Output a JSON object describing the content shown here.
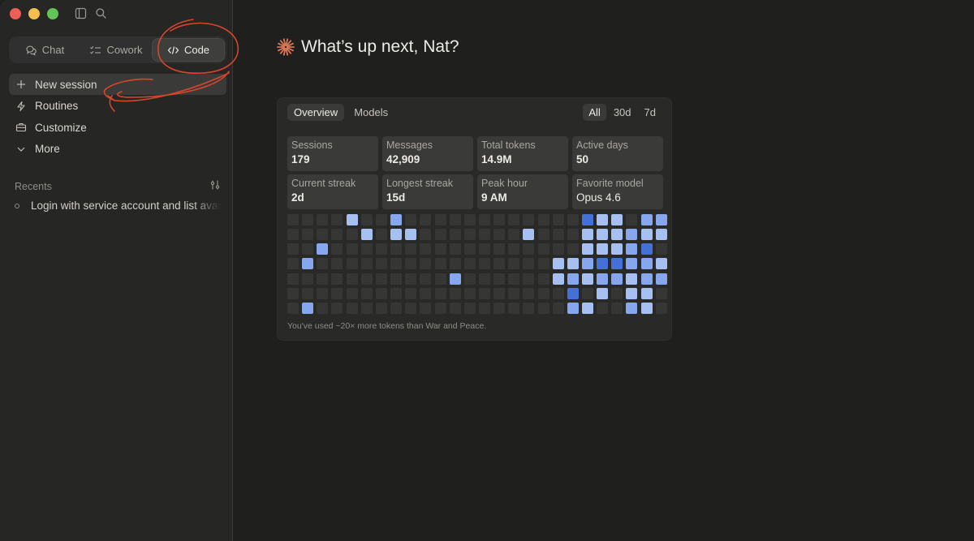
{
  "window": {
    "traffic_lights": [
      "close",
      "minimize",
      "zoom"
    ]
  },
  "sidebar": {
    "modes": [
      {
        "label": "Chat",
        "icon": "chat-bubbles-icon",
        "active": false
      },
      {
        "label": "Cowork",
        "icon": "checklist-icon",
        "active": false
      },
      {
        "label": "Code",
        "icon": "code-brackets-icon",
        "active": true
      }
    ],
    "nav": [
      {
        "label": "New session",
        "icon": "plus-icon",
        "active": true
      },
      {
        "label": "Routines",
        "icon": "lightning-icon",
        "active": false
      },
      {
        "label": "Customize",
        "icon": "briefcase-icon",
        "active": false
      },
      {
        "label": "More",
        "icon": "chevron-down-icon",
        "active": false
      }
    ],
    "recents_label": "Recents",
    "recents": [
      {
        "label": "Login with service account and list available"
      }
    ]
  },
  "main": {
    "greeting": "What’s up next, Nat?",
    "accent_color": "#d97757"
  },
  "stats_card": {
    "tabs": [
      {
        "label": "Overview",
        "active": true
      },
      {
        "label": "Models",
        "active": false
      }
    ],
    "ranges": [
      {
        "label": "All",
        "active": true
      },
      {
        "label": "30d",
        "active": false
      },
      {
        "label": "7d",
        "active": false
      }
    ],
    "stats": [
      {
        "label": "Sessions",
        "value": "179"
      },
      {
        "label": "Messages",
        "value": "42,909"
      },
      {
        "label": "Total tokens",
        "value": "14.9M"
      },
      {
        "label": "Active days",
        "value": "50"
      },
      {
        "label": "Current streak",
        "value": "2d"
      },
      {
        "label": "Longest streak",
        "value": "15d"
      },
      {
        "label": "Peak hour",
        "value": "9 AM"
      },
      {
        "label": "Favorite model",
        "value": "Opus 4.6"
      }
    ],
    "heatmap_colors": [
      "#363635",
      "#a6c0f2",
      "#86a6ee",
      "#4470d8"
    ],
    "heatmap": [
      [
        0,
        0,
        0,
        0,
        1,
        0,
        0,
        2,
        0,
        0,
        0,
        0,
        0,
        0,
        0,
        0,
        0,
        0,
        0,
        0,
        3,
        1,
        1,
        0,
        2,
        2
      ],
      [
        0,
        0,
        0,
        0,
        0,
        1,
        0,
        1,
        1,
        0,
        0,
        0,
        0,
        0,
        0,
        0,
        1,
        0,
        0,
        0,
        1,
        1,
        1,
        2,
        1,
        1
      ],
      [
        0,
        0,
        2,
        0,
        0,
        0,
        0,
        0,
        0,
        0,
        0,
        0,
        0,
        0,
        0,
        0,
        0,
        0,
        0,
        0,
        1,
        1,
        1,
        2,
        3,
        0
      ],
      [
        0,
        2,
        0,
        0,
        0,
        0,
        0,
        0,
        0,
        0,
        0,
        0,
        0,
        0,
        0,
        0,
        0,
        0,
        1,
        1,
        2,
        3,
        3,
        2,
        2,
        1
      ],
      [
        0,
        0,
        0,
        0,
        0,
        0,
        0,
        0,
        0,
        0,
        0,
        2,
        0,
        0,
        0,
        0,
        0,
        0,
        1,
        2,
        1,
        2,
        2,
        1,
        2,
        2
      ],
      [
        0,
        0,
        0,
        0,
        0,
        0,
        0,
        0,
        0,
        0,
        0,
        0,
        0,
        0,
        0,
        0,
        0,
        0,
        0,
        3,
        0,
        1,
        0,
        1,
        1,
        0
      ],
      [
        0,
        2,
        0,
        0,
        0,
        0,
        0,
        0,
        0,
        0,
        0,
        0,
        0,
        0,
        0,
        0,
        0,
        0,
        0,
        2,
        1,
        0,
        0,
        2,
        1,
        0
      ]
    ],
    "footnote": "You've used ~20× more tokens than War and Peace."
  }
}
